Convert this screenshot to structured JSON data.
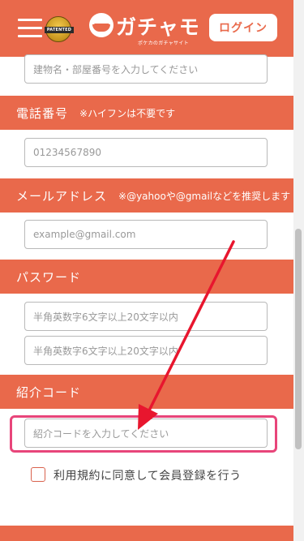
{
  "header": {
    "logo_text": "ガチャモ",
    "logo_sub": "ポケカのガチャサイト",
    "badge_text": "PATENTED",
    "login_label": "ログイン"
  },
  "form": {
    "building_placeholder": "建物名・部屋番号を入力してください",
    "phone": {
      "title": "電話番号",
      "note": "※ハイフンは不要です",
      "placeholder": "01234567890"
    },
    "email": {
      "title": "メールアドレス",
      "note": "※@yahooや@gmailなどを推奨します",
      "placeholder": "example@gmail.com"
    },
    "password": {
      "title": "パスワード",
      "placeholder": "半角英数字6文字以上20文字以内",
      "confirm_placeholder": "半角英数字6文字以上20文字以内"
    },
    "referral": {
      "title": "紹介コード",
      "placeholder": "紹介コードを入力してください"
    },
    "terms_label": "利用規約に同意して会員登録を行う"
  },
  "colors": {
    "brand": "#e9694b",
    "highlight": "#e8457a",
    "arrow": "#e8162e"
  },
  "icons": {
    "menu": "hamburger-menu-icon",
    "badge": "patented-badge-icon",
    "logo": "gachamo-logo-icon"
  }
}
